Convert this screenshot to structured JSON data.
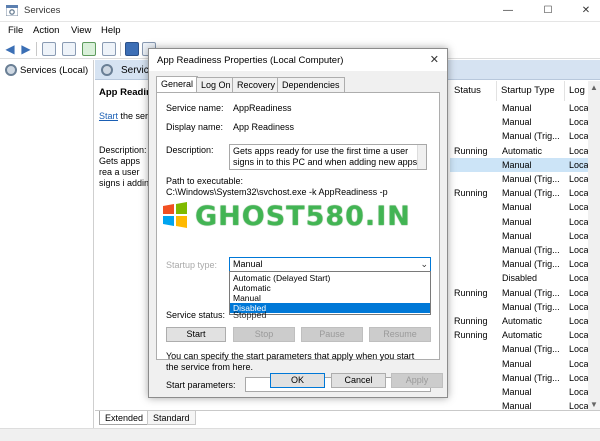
{
  "window": {
    "title": "Services",
    "controls": {
      "minimize": "—",
      "maximize": "☐",
      "close": "✕"
    }
  },
  "menu": [
    "File",
    "Action",
    "View",
    "Help"
  ],
  "tree": {
    "root": "Services (Local)"
  },
  "header": {
    "title": "Services"
  },
  "left_pane": {
    "service_name": "App Readine",
    "start_prefix": "Start",
    "start_suffix": " the serv",
    "description_title": "Description:",
    "description_text": "Gets apps rea a user signs i adding new a"
  },
  "columns": {
    "status": "Status",
    "startup_type": "Startup Type",
    "log_on": "Log"
  },
  "rows": [
    {
      "status": "",
      "startup": "Manual",
      "log": "Loca"
    },
    {
      "status": "",
      "startup": "Manual",
      "log": "Loca"
    },
    {
      "status": "",
      "startup": "Manual (Trig...",
      "log": "Loca"
    },
    {
      "status": "Running",
      "startup": "Automatic",
      "log": "Loca"
    },
    {
      "status": "",
      "startup": "Manual",
      "log": "Loca",
      "selected": true
    },
    {
      "status": "",
      "startup": "Manual (Trig...",
      "log": "Loca"
    },
    {
      "status": "Running",
      "startup": "Manual (Trig...",
      "log": "Loca"
    },
    {
      "status": "",
      "startup": "Manual",
      "log": "Loca"
    },
    {
      "status": "",
      "startup": "Manual",
      "log": "Loca"
    },
    {
      "status": "",
      "startup": "Manual",
      "log": "Loca"
    },
    {
      "status": "",
      "startup": "Manual (Trig...",
      "log": "Loca"
    },
    {
      "status": "",
      "startup": "Manual (Trig...",
      "log": "Loca"
    },
    {
      "status": "",
      "startup": "Disabled",
      "log": "Loca"
    },
    {
      "status": "Running",
      "startup": "Manual (Trig...",
      "log": "Loca"
    },
    {
      "status": "",
      "startup": "Manual (Trig...",
      "log": "Loca"
    },
    {
      "status": "Running",
      "startup": "Automatic",
      "log": "Loca"
    },
    {
      "status": "Running",
      "startup": "Automatic",
      "log": "Loca"
    },
    {
      "status": "",
      "startup": "Manual (Trig...",
      "log": "Loca"
    },
    {
      "status": "",
      "startup": "Manual",
      "log": "Loca"
    },
    {
      "status": "",
      "startup": "Manual (Trig...",
      "log": "Loca"
    },
    {
      "status": "",
      "startup": "Manual",
      "log": "Loca"
    },
    {
      "status": "",
      "startup": "Manual",
      "log": "Loca"
    }
  ],
  "bottom_tabs": [
    "Extended",
    "Standard"
  ],
  "dialog": {
    "title": "App Readiness Properties (Local Computer)",
    "close": "✕",
    "tabs": [
      "General",
      "Log On",
      "Recovery",
      "Dependencies"
    ],
    "service_name_label": "Service name:",
    "service_name": "AppReadiness",
    "display_name_label": "Display name:",
    "display_name": "App Readiness",
    "description_label": "Description:",
    "description": "Gets apps ready for use the first time a user signs in to this PC and when adding new apps.",
    "path_label": "Path to executable:",
    "path": "C:\\Windows\\System32\\svchost.exe -k AppReadiness -p",
    "startup_label": "Startup type:",
    "startup_value": "Manual",
    "startup_options": [
      "Automatic (Delayed Start)",
      "Automatic",
      "Manual",
      "Disabled"
    ],
    "status_label": "Service status:",
    "status_value": "Stopped",
    "buttons": {
      "start": "Start",
      "stop": "Stop",
      "pause": "Pause",
      "resume": "Resume"
    },
    "hint": "You can specify the start parameters that apply when you start the service from here.",
    "params_label": "Start parameters:",
    "ok": "OK",
    "cancel": "Cancel",
    "apply": "Apply"
  },
  "watermark": "GHOST580.IN",
  "colors": {
    "accent": "#0078d7",
    "selection": "#cce4f7",
    "header_strip": "#d6e3f2",
    "watermark": "#46be5a"
  }
}
